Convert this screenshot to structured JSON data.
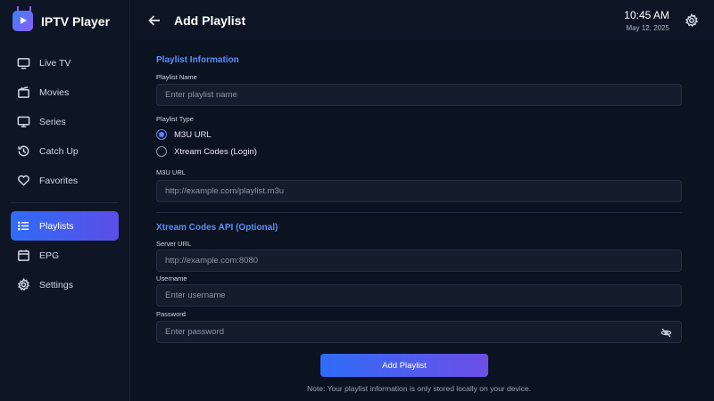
{
  "app": {
    "name": "IPTV Player"
  },
  "sidebar": {
    "items": [
      {
        "label": "Live TV",
        "icon": "tv-icon"
      },
      {
        "label": "Movies",
        "icon": "film-icon"
      },
      {
        "label": "Series",
        "icon": "monitor-icon"
      },
      {
        "label": "Catch Up",
        "icon": "history-icon"
      },
      {
        "label": "Favorites",
        "icon": "heart-icon"
      },
      {
        "label": "Playlists",
        "icon": "list-icon",
        "active": true
      },
      {
        "label": "EPG",
        "icon": "calendar-icon"
      },
      {
        "label": "Settings",
        "icon": "gear-icon"
      }
    ]
  },
  "header": {
    "title": "Add Playlist",
    "time": "10:45 AM",
    "date": "May 12, 2025"
  },
  "form": {
    "section1_title": "Playlist Information",
    "playlist_name_label": "Playlist Name",
    "playlist_name_placeholder": "Enter playlist name",
    "playlist_type_label": "Playlist Type",
    "type_options": [
      {
        "label": "M3U URL",
        "selected": true
      },
      {
        "label": "Xtream Codes (Login)",
        "selected": false
      }
    ],
    "m3u_label": "M3U URL",
    "m3u_placeholder": "http://example.com/playlist.m3u",
    "section2_title": "Xtream Codes API (Optional)",
    "server_label": "Server URL",
    "server_placeholder": "http://example.com:8080",
    "username_label": "Username",
    "username_placeholder": "Enter username",
    "password_label": "Password",
    "password_placeholder": "Enter password",
    "submit_label": "Add Playlist",
    "note": "Note: Your playlist information is only stored locally on your device."
  },
  "colors": {
    "accent": "#5b8ef8",
    "gradient_start": "#2f6cf6",
    "gradient_end": "#6d4fe6",
    "background": "#0b1220"
  }
}
